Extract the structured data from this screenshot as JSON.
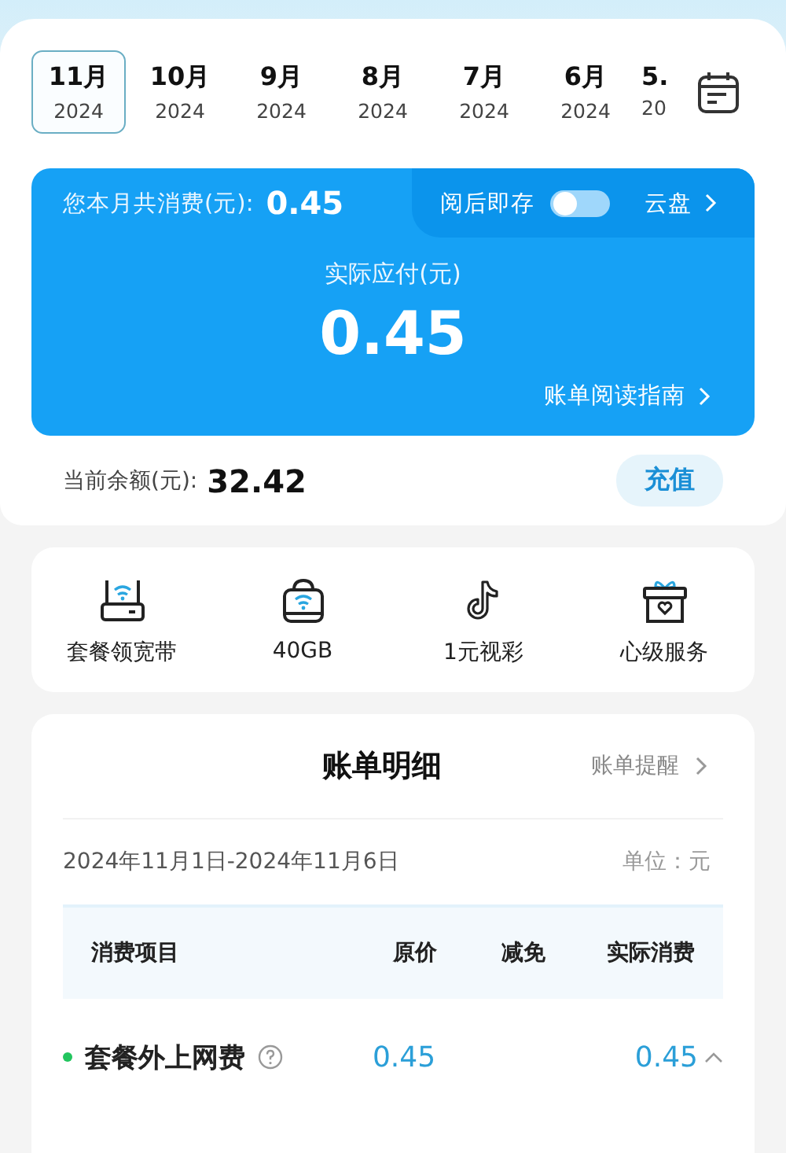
{
  "months": [
    {
      "month": "11月",
      "year": "2024",
      "selected": true
    },
    {
      "month": "10月",
      "year": "2024",
      "selected": false
    },
    {
      "month": "9月",
      "year": "2024",
      "selected": false
    },
    {
      "month": "8月",
      "year": "2024",
      "selected": false
    },
    {
      "month": "7月",
      "year": "2024",
      "selected": false
    },
    {
      "month": "6月",
      "year": "2024",
      "selected": false
    },
    {
      "month": "5.",
      "year": "20",
      "selected": false
    }
  ],
  "summary": {
    "total_label": "您本月共消费(元):",
    "total_value": "0.45",
    "save_label": "阅后即存",
    "save_toggle": {
      "on": false
    },
    "cloud_link": "云盘",
    "payable_label": "实际应付(元)",
    "payable_value": "0.45",
    "guide_link": "账单阅读指南"
  },
  "balance": {
    "label": "当前余额(元):",
    "value": "32.42",
    "button": "充值"
  },
  "shortcuts": [
    {
      "kind": "router",
      "label": "套餐领宽带"
    },
    {
      "kind": "bag",
      "label": "40GB"
    },
    {
      "kind": "note",
      "label": "1元视彩"
    },
    {
      "kind": "gift",
      "label": "心级服务"
    }
  ],
  "details": {
    "title": "账单明细",
    "reminder_link": "账单提醒",
    "period": "2024年11月1日-2024年11月6日",
    "unit": "单位：元",
    "columns": [
      "消费项目",
      "原价",
      "减免",
      "实际消费"
    ],
    "rows": [
      {
        "item": "套餐外上网费",
        "color": "#22c55e",
        "original": "0.45",
        "actual": "0.45",
        "expanded": true
      }
    ]
  }
}
